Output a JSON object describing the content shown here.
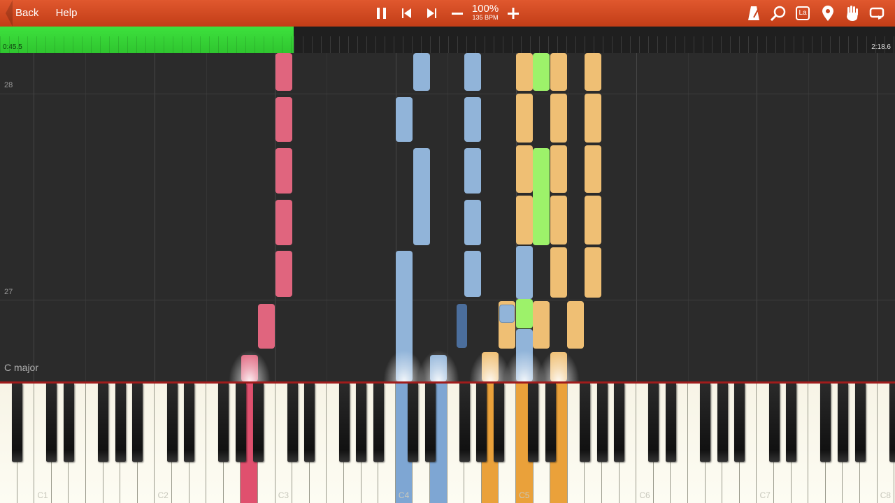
{
  "toolbar": {
    "back_label": "Back",
    "help_label": "Help",
    "speed_percent": "100%",
    "tempo": "135 BPM",
    "icons": [
      "pause-icon",
      "skip-back-icon",
      "skip-forward-icon",
      "minus-icon",
      "plus-icon",
      "metronome-icon",
      "search-icon",
      "note-label-icon",
      "location-pin-icon",
      "hand-icon",
      "loop-icon"
    ],
    "note_label_glyph": "La",
    "accent_color": "#d44a22"
  },
  "timeline": {
    "current_time": "0:45.5",
    "total_time": "2:18.6",
    "progress": 0.328,
    "progress_color": "#37d637"
  },
  "roll": {
    "measures": [
      "28",
      "27"
    ],
    "key_signature": "C major",
    "track_colors": {
      "pink": "#e0657e",
      "blue": "#91b4d9",
      "dark_blue": "#4b6e9c",
      "orange": "#efbf74",
      "green": "#9df26a"
    }
  },
  "keyboard": {
    "octave_labels": [
      "C1",
      "C2",
      "C3",
      "C4",
      "C5",
      "C6",
      "C7",
      "C8"
    ],
    "pressed_keys": [
      {
        "color": "#e0506e"
      },
      {
        "color": "#7ea6d3"
      },
      {
        "color": "#7ea6d3"
      },
      {
        "color": "#eaa13a"
      },
      {
        "color": "#eaa13a"
      },
      {
        "color": "#eaa13a"
      }
    ]
  }
}
